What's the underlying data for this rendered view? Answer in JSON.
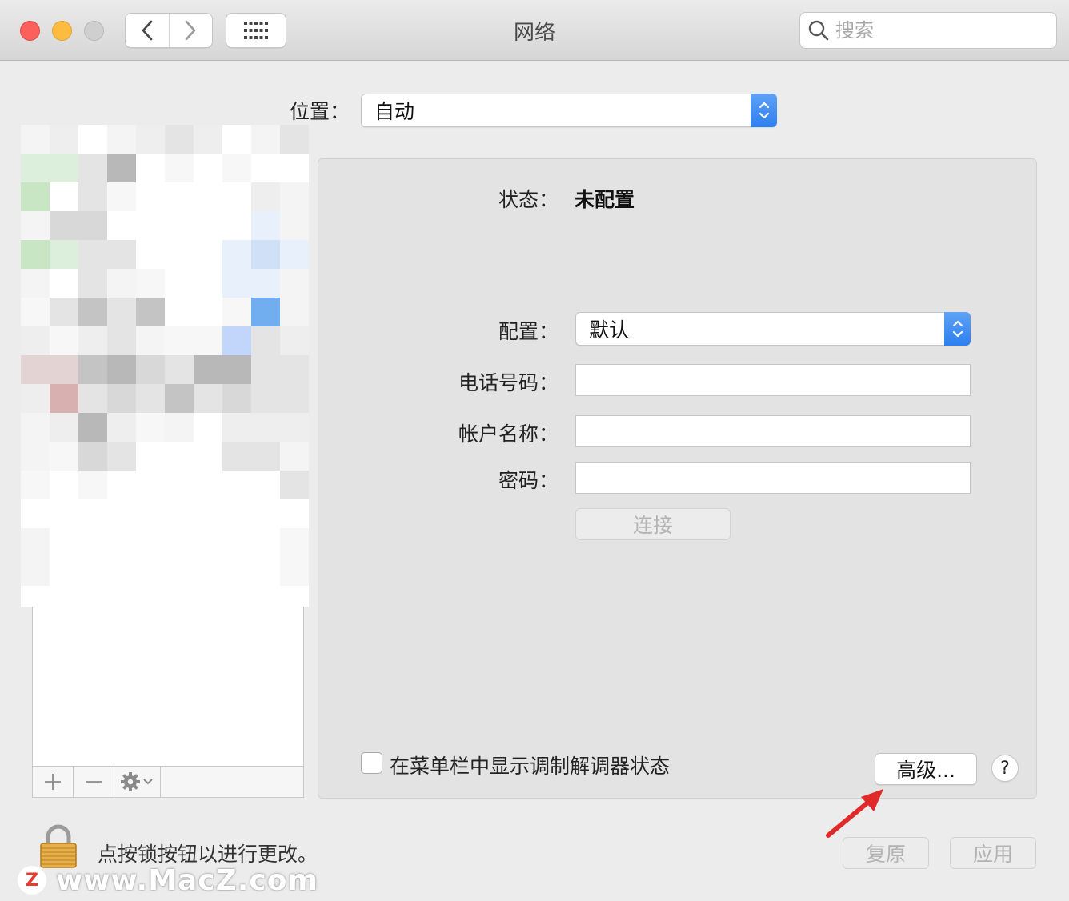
{
  "window": {
    "title": "网络"
  },
  "search": {
    "placeholder": "搜索"
  },
  "location": {
    "label": "位置：",
    "value": "自动"
  },
  "status": {
    "label": "状态：",
    "value": "未配置"
  },
  "form": {
    "config_label": "配置：",
    "config_value": "默认",
    "phone_label": "电话号码：",
    "phone_value": "",
    "account_label": "帐户名称：",
    "account_value": "",
    "password_label": "密码：",
    "password_value": "",
    "connect_label": "连接"
  },
  "modem_status": {
    "label": "在菜单栏中显示调制解调器状态",
    "checked": false
  },
  "advanced_label": "高级...",
  "help_label": "?",
  "lock": {
    "text": "点按锁按钮以进行更改。"
  },
  "footer": {
    "revert_label": "复原",
    "apply_label": "应用"
  },
  "watermark": {
    "logo": "Z",
    "text": "www.MacZ.com"
  },
  "colors": {
    "accent": "#2d7ff0",
    "close": "#fc605c",
    "minimize": "#fdbc40",
    "annotation_arrow": "#e02a2a"
  },
  "icons": [
    "back-icon",
    "forward-icon",
    "grid-icon",
    "search-icon",
    "stepper-icon",
    "add-icon",
    "remove-icon",
    "gear-icon",
    "lock-icon",
    "help-icon"
  ]
}
